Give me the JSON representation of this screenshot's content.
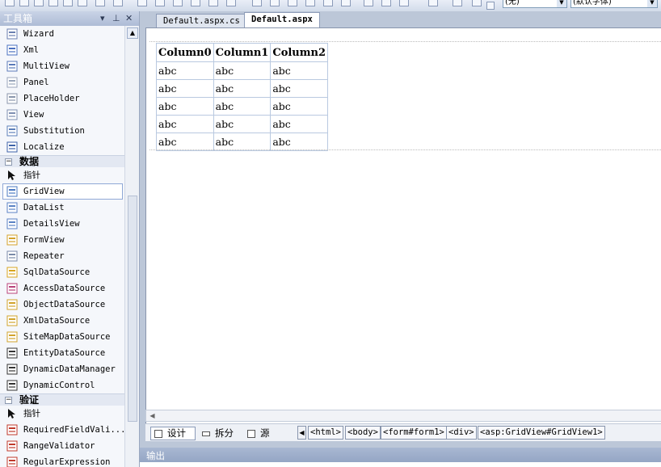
{
  "toolbox": {
    "title": "工具箱",
    "pin_glyph": "▾ ᵖ",
    "close_glyph": "✕",
    "items": [
      {
        "label": "Wizard",
        "icon": "wizard-icon"
      },
      {
        "label": "Xml",
        "icon": "xml-icon"
      },
      {
        "label": "MultiView",
        "icon": "multiview-icon"
      },
      {
        "label": "Panel",
        "icon": "panel-icon"
      },
      {
        "label": "PlaceHolder",
        "icon": "placeholder-icon"
      },
      {
        "label": "View",
        "icon": "view-icon"
      },
      {
        "label": "Substitution",
        "icon": "substitution-icon"
      },
      {
        "label": "Localize",
        "icon": "localize-icon"
      }
    ],
    "category_data": "数据",
    "data_items": [
      {
        "label": "指针",
        "icon": "pointer-icon"
      },
      {
        "label": "GridView",
        "icon": "gridview-icon",
        "selected": true
      },
      {
        "label": "DataList",
        "icon": "datalist-icon"
      },
      {
        "label": "DetailsView",
        "icon": "detailsview-icon"
      },
      {
        "label": "FormView",
        "icon": "formview-icon"
      },
      {
        "label": "Repeater",
        "icon": "repeater-icon"
      },
      {
        "label": "SqlDataSource",
        "icon": "sqldatasource-icon"
      },
      {
        "label": "AccessDataSource",
        "icon": "accessdatasource-icon"
      },
      {
        "label": "ObjectDataSource",
        "icon": "objectdatasource-icon"
      },
      {
        "label": "XmlDataSource",
        "icon": "xmldatasource-icon"
      },
      {
        "label": "SiteMapDataSource",
        "icon": "sitemapdatasource-icon"
      },
      {
        "label": "EntityDataSource",
        "icon": "entitydatasource-icon"
      },
      {
        "label": "DynamicDataManager",
        "icon": "dynamicdatamanager-icon"
      },
      {
        "label": "DynamicControl",
        "icon": "dynamiccontrol-icon"
      }
    ],
    "category_validation": "验证",
    "validation_items": [
      {
        "label": "指针",
        "icon": "pointer-icon"
      },
      {
        "label": "RequiredFieldVali...",
        "icon": "requiredfieldvalidator-icon"
      },
      {
        "label": "RangeValidator",
        "icon": "rangevalidator-icon"
      },
      {
        "label": "RegularExpression",
        "icon": "regularexpression-icon"
      }
    ]
  },
  "toolbar": {
    "combo1": "(无)",
    "combo2": "(默认字体)"
  },
  "tabs": [
    {
      "label": "Default.aspx.cs",
      "active": false
    },
    {
      "label": "Default.aspx",
      "active": true
    }
  ],
  "gridview": {
    "columns": [
      "Column0",
      "Column1",
      "Column2"
    ],
    "rows": [
      [
        "abc",
        "abc",
        "abc"
      ],
      [
        "abc",
        "abc",
        "abc"
      ],
      [
        "abc",
        "abc",
        "abc"
      ],
      [
        "abc",
        "abc",
        "abc"
      ],
      [
        "abc",
        "abc",
        "abc"
      ]
    ]
  },
  "view_buttons": {
    "design": "设计",
    "split": "拆分",
    "source": "源"
  },
  "breadcrumbs": [
    "<html>",
    "<body>",
    "<form#form1>",
    "<div>",
    "<asp:GridView#GridView1>"
  ],
  "output": {
    "title": "输出"
  },
  "colors": {
    "accent": "#8d9fc0",
    "selection_border": "#8fa8d6",
    "grid_border": "#b9c9e0"
  }
}
